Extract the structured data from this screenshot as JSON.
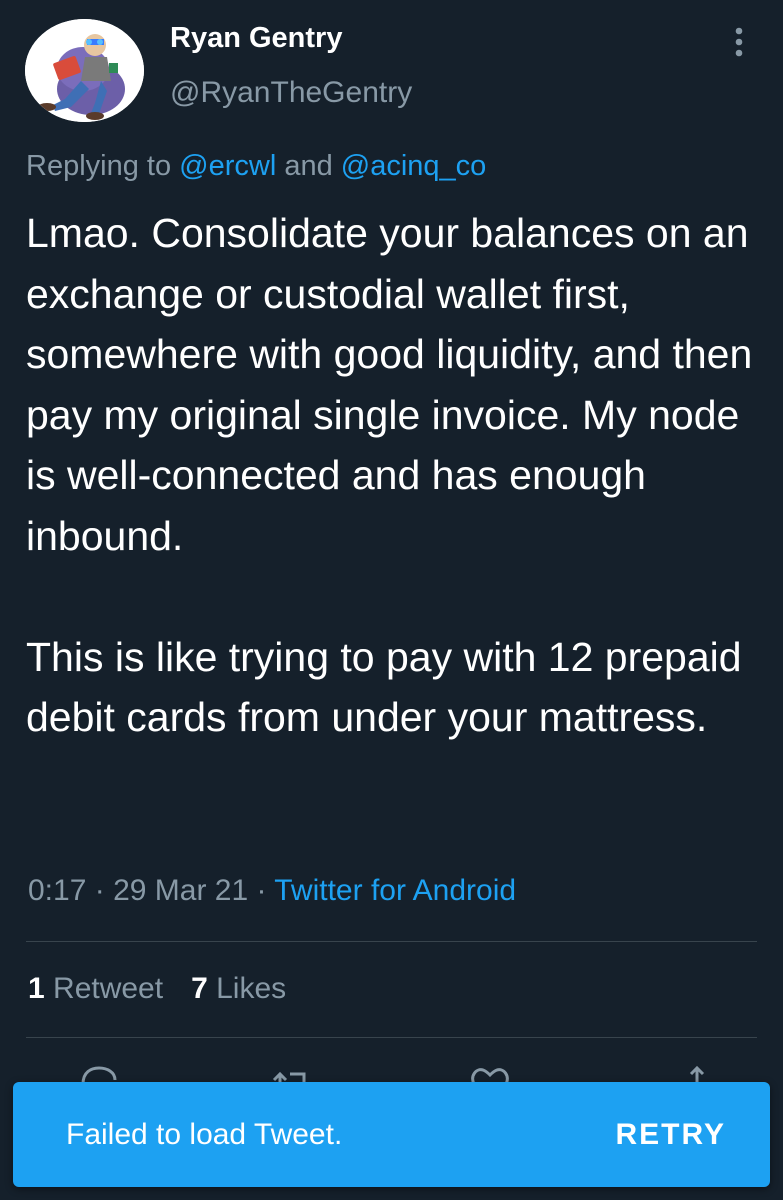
{
  "colors": {
    "background": "#15202b",
    "text_primary": "#ffffff",
    "text_secondary": "#8899a6",
    "accent": "#1da1f2",
    "divider": "#38444d"
  },
  "tweet": {
    "author": {
      "display_name": "Ryan Gentry",
      "handle": "@RyanTheGentry",
      "avatar_icon": "avatar-illustration"
    },
    "more_icon": "more-vertical-icon",
    "reply": {
      "prefix": "Replying to ",
      "mention_1": "@ercwl",
      "joiner": " and ",
      "mention_2": "@acinq_co"
    },
    "text": {
      "paragraph_1": "Lmao. Consolidate your balances on an exchange or custodial wallet first, somewhere with good liquidity, and then pay my original single invoice. My node is well-connected and has enough inbound.",
      "paragraph_2": "This is like trying to pay with 12 prepaid debit cards from under your mattress."
    },
    "meta": {
      "time": "0:17",
      "separator_1": " · ",
      "date": "29 Mar 21",
      "separator_2": " · ",
      "source": "Twitter for Android"
    },
    "stats": {
      "retweets_count": "1",
      "retweets_label": " Retweet",
      "likes_count": "7",
      "likes_label": " Likes"
    },
    "actions": [
      "reply-icon",
      "retweet-icon",
      "like-icon",
      "share-icon"
    ]
  },
  "toast": {
    "message": "Failed to load Tweet.",
    "retry_label": "RETRY"
  }
}
